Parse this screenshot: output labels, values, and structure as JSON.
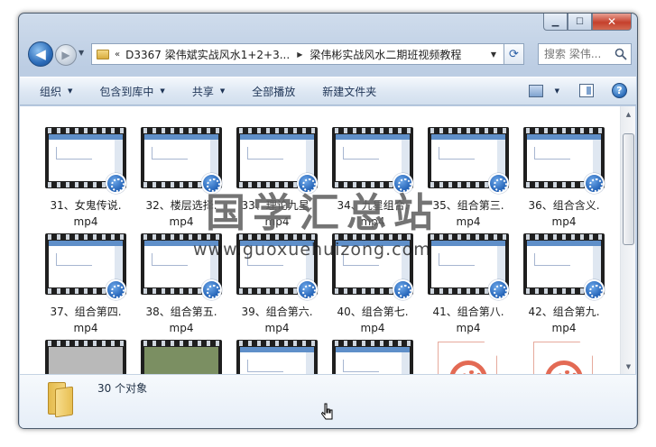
{
  "address": {
    "overflow": "«",
    "segments": [
      "D3367 梁伟斌实战风水1+2+3...",
      "梁伟彬实战风水二期班视频教程"
    ]
  },
  "search": {
    "placeholder": "搜索 梁伟..."
  },
  "toolbar": {
    "organize": "组织",
    "include_in_library": "包含到库中",
    "share": "共享",
    "play_all": "全部播放",
    "new_folder": "新建文件夹"
  },
  "files": [
    {
      "name": "31、女鬼传说.",
      "ext": "mp4",
      "kind": "video"
    },
    {
      "name": "32、楼层选择.",
      "ext": "mp4",
      "kind": "video"
    },
    {
      "name": "33、理论九星.",
      "ext": "mp4",
      "kind": "video"
    },
    {
      "name": "34、九星组合.",
      "ext": "mp4",
      "kind": "video"
    },
    {
      "name": "35、组合第三.",
      "ext": "mp4",
      "kind": "video"
    },
    {
      "name": "36、组合含义.",
      "ext": "mp4",
      "kind": "video"
    },
    {
      "name": "37、组合第四.",
      "ext": "mp4",
      "kind": "video"
    },
    {
      "name": "38、组合第五.",
      "ext": "mp4",
      "kind": "video"
    },
    {
      "name": "39、组合第六.",
      "ext": "mp4",
      "kind": "video"
    },
    {
      "name": "40、组合第七.",
      "ext": "mp4",
      "kind": "video"
    },
    {
      "name": "41、组合第八.",
      "ext": "mp4",
      "kind": "video"
    },
    {
      "name": "42、组合第九.",
      "ext": "mp4",
      "kind": "video"
    },
    {
      "name": "",
      "ext": "",
      "kind": "video-gray"
    },
    {
      "name": "",
      "ext": "",
      "kind": "video-green"
    },
    {
      "name": "",
      "ext": "",
      "kind": "video"
    },
    {
      "name": "",
      "ext": "",
      "kind": "video"
    },
    {
      "name": "",
      "ext": "",
      "kind": "document"
    },
    {
      "name": "",
      "ext": "",
      "kind": "document"
    }
  ],
  "details": {
    "count": "30 个对象"
  },
  "watermark": {
    "text": "国学汇总站",
    "url": "www.guoxuehuizong.com"
  },
  "icons": {
    "back": "arrow-left-icon",
    "forward": "arrow-right-icon",
    "refresh": "refresh-icon",
    "search": "search-icon",
    "help": "help-icon"
  },
  "colors": {
    "accent": "#2c6cb9",
    "video_badge": "#1f5fb4",
    "media_doc": "#e36a54"
  }
}
